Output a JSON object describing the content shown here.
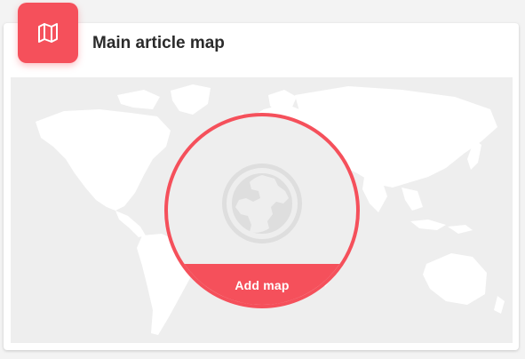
{
  "card": {
    "title": "Main article map",
    "header_icon": "map-icon"
  },
  "map_area": {
    "background_icon": "world-map-silhouette",
    "center_icon": "globe-icon",
    "add_button_label": "Add map"
  },
  "colors": {
    "accent": "#f5505b",
    "map_bg": "#eeeeee",
    "land": "#ffffff"
  }
}
